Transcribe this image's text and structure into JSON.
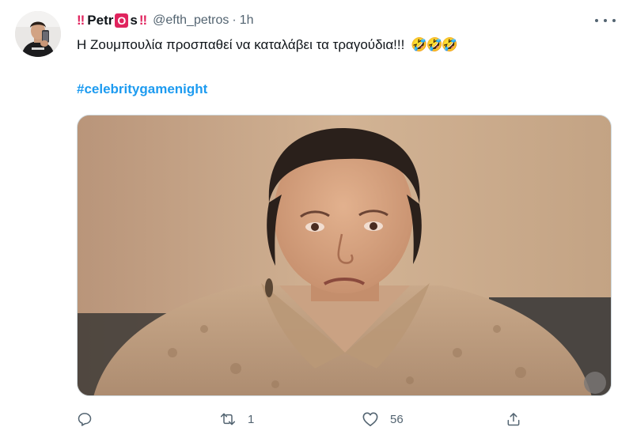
{
  "tweet": {
    "display_name_prefix": "‼",
    "display_name_suffix": "‼",
    "display_name_part1": "Petr",
    "display_name_boxed": "O",
    "display_name_part2": "s",
    "handle": "@efth_petros",
    "separator": "·",
    "time": "1h",
    "text": "Η Ζουμπουλία προσπαθεί να καταλάβει τα τραγούδια!!!",
    "emojis": "🤣🤣🤣",
    "hashtag": "#celebritygamenight"
  },
  "actions": {
    "reply_count": "",
    "retweet_count": "1",
    "like_count": "56",
    "share_count": ""
  },
  "colors": {
    "accent": "#1d9bf0",
    "name_badge": "#e0245e",
    "muted": "#536471"
  },
  "icons": {
    "reply": "speech-bubble-icon",
    "retweet": "retweet-arrows-icon",
    "like": "heart-icon",
    "share": "share-upload-icon",
    "more": "more-horizontal-icon"
  }
}
